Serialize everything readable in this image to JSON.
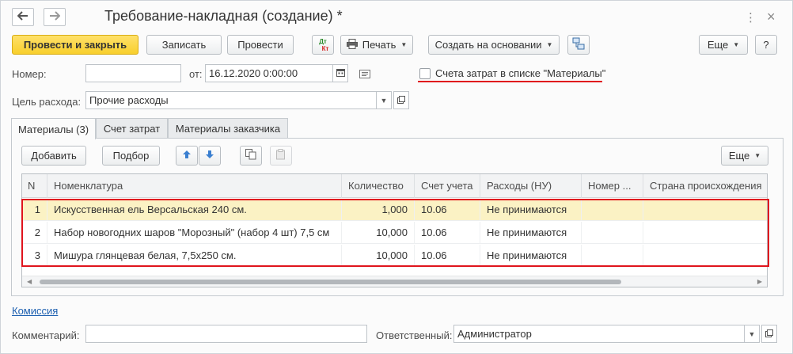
{
  "window": {
    "title": "Требование-накладная (создание) *",
    "nav_back": "🡐",
    "nav_forward": "🡒",
    "menu_glyph": "⋮",
    "close_glyph": "×"
  },
  "toolbar": {
    "post_close": "Провести и закрыть",
    "save": "Записать",
    "post": "Провести",
    "dtkt_top": "Дт",
    "dtkt_bottom": "Кт",
    "print": "Печать",
    "create_based": "Создать на основании",
    "more": "Еще",
    "help": "?"
  },
  "header": {
    "number_label": "Номер:",
    "number_value": "",
    "date_label": "от:",
    "date_value": "16.12.2020  0:00:00",
    "cost_accounts_checkbox": "Счета затрат в списке \"Материалы\"",
    "cost_accounts_checked": false,
    "purpose_label": "Цель расхода:",
    "purpose_value": "Прочие расходы"
  },
  "tabs": [
    {
      "label": "Материалы (3)",
      "active": true
    },
    {
      "label": "Счет затрат",
      "active": false
    },
    {
      "label": "Материалы заказчика",
      "active": false
    }
  ],
  "grid_toolbar": {
    "add": "Добавить",
    "pick": "Подбор",
    "more": "Еще"
  },
  "table": {
    "columns": [
      "N",
      "Номенклатура",
      "Количество",
      "Счет учета",
      "Расходы (НУ)",
      "Номер ...",
      "Страна происхождения"
    ],
    "rows": [
      {
        "n": "1",
        "item": "Искусственная ель Версальская 240 см.",
        "qty": "1,000",
        "account": "10.06",
        "expense": "Не принимаются",
        "number": "",
        "country": ""
      },
      {
        "n": "2",
        "item": "Набор новогодних шаров \"Морозный\" (набор 4 шт) 7,5 см",
        "qty": "10,000",
        "account": "10.06",
        "expense": "Не принимаются",
        "number": "",
        "country": ""
      },
      {
        "n": "3",
        "item": "Мишура глянцевая белая, 7,5х250 см.",
        "qty": "10,000",
        "account": "10.06",
        "expense": "Не принимаются",
        "number": "",
        "country": ""
      }
    ]
  },
  "footer": {
    "commission_link": "Комиссия",
    "comment_label": "Комментарий:",
    "comment_value": "",
    "responsible_label": "Ответственный:",
    "responsible_value": "Администратор"
  },
  "colors": {
    "primary_button": "#f8cf2c",
    "selected_row": "#fbf2c4",
    "highlight": "#e0141d",
    "link": "#1c5fb0"
  }
}
